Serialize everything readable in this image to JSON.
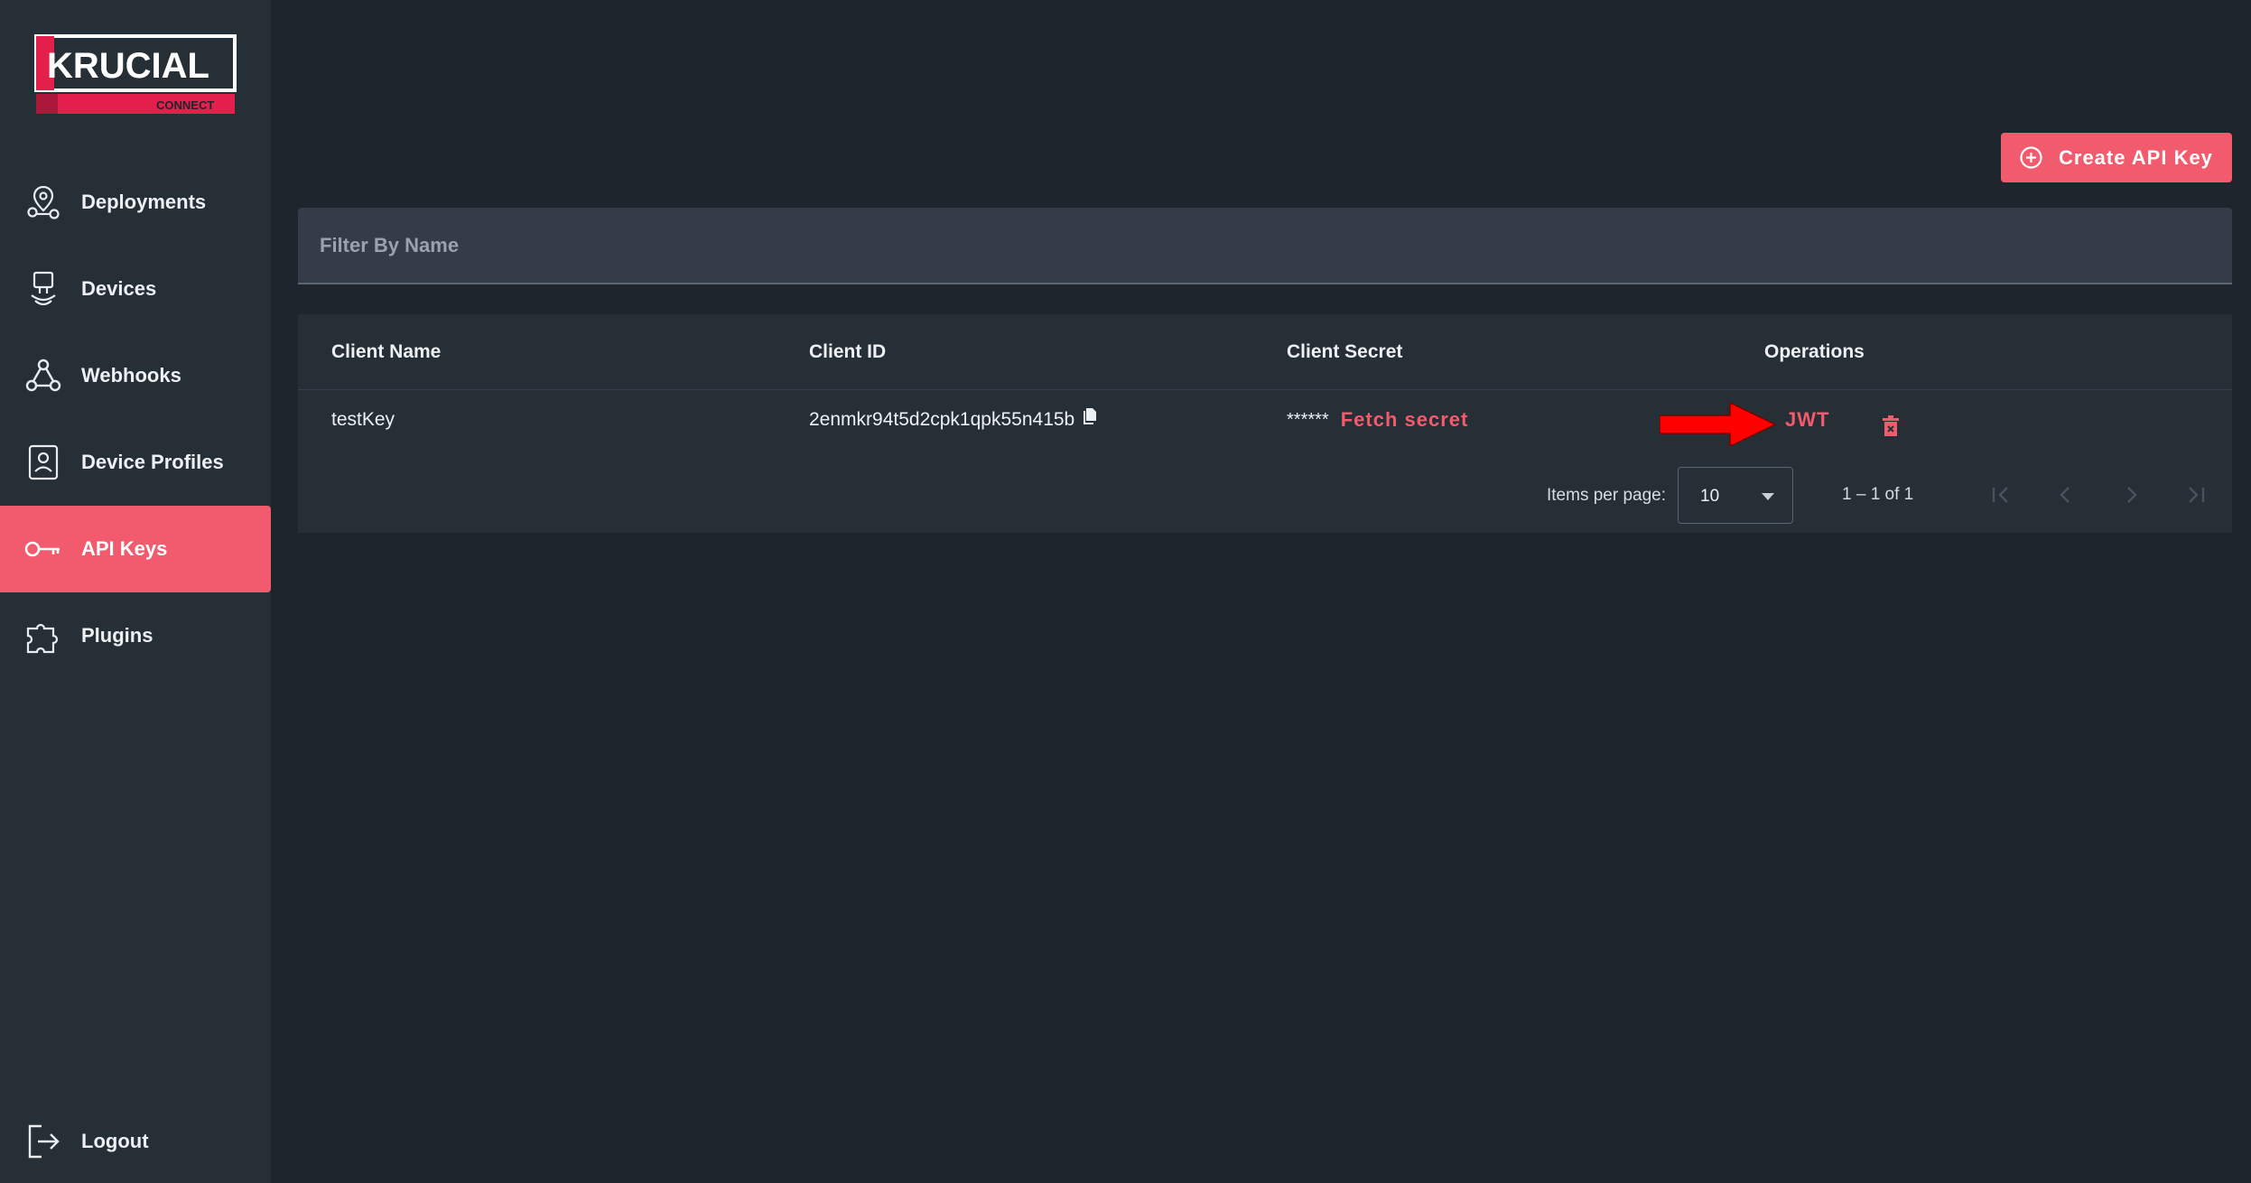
{
  "brand": {
    "name": "KRUCIAL",
    "sub": "CONNECT",
    "accent": "#f25b6d",
    "logo_red": "#e31f4b"
  },
  "sidebar": {
    "items": [
      {
        "label": "Deployments",
        "icon": "map-pin-icon"
      },
      {
        "label": "Devices",
        "icon": "device-icon"
      },
      {
        "label": "Webhooks",
        "icon": "webhook-icon"
      },
      {
        "label": "Device Profiles",
        "icon": "profile-icon"
      },
      {
        "label": "API Keys",
        "icon": "key-icon",
        "active": true
      },
      {
        "label": "Plugins",
        "icon": "puzzle-icon"
      }
    ],
    "logout": {
      "label": "Logout",
      "icon": "logout-icon"
    }
  },
  "toolbar": {
    "create_label": "Create API Key",
    "create_icon": "add-circle-icon"
  },
  "filter": {
    "placeholder": "Filter By Name"
  },
  "table": {
    "headers": {
      "client_name": "Client Name",
      "client_id": "Client ID",
      "client_secret": "Client Secret",
      "operations": "Operations"
    },
    "rows": [
      {
        "client_name": "testKey",
        "client_id": "2enmkr94t5d2cpk1qpk55n415b",
        "secret_mask": "******",
        "fetch_label": "Fetch secret",
        "jwt_label": "JWT"
      }
    ]
  },
  "pagination": {
    "items_per_page_label": "Items per page:",
    "page_size": "10",
    "range_label": "1 – 1 of 1"
  }
}
